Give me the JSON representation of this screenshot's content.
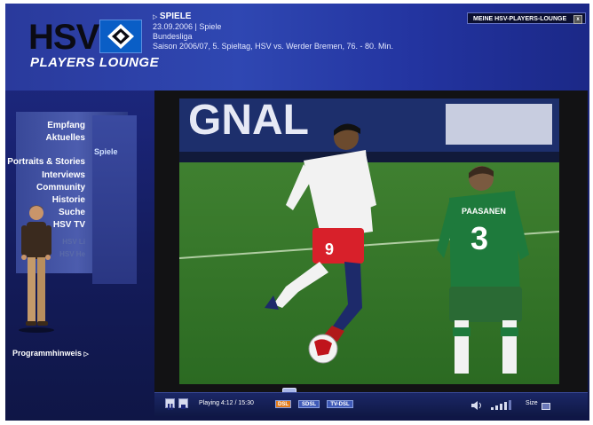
{
  "header": {
    "logo_main": "HSV",
    "logo_sub": "PLAYERS LOUNGE",
    "section": "SPIELE",
    "date_line": "23.09.2006 | Spiele",
    "league": "Bundesliga",
    "match_info": "Saison 2006/07, 5. Spieltag, HSV vs. Werder Bremen, 76. - 80. Min.",
    "lounge_button": "MEINE HSV-PLAYERS-LOUNGE",
    "close_label": "x"
  },
  "nav": {
    "items": [
      "Empfang",
      "Aktuelles",
      "Portraits & Stories",
      "Interviews",
      "Community",
      "Historie",
      "Suche",
      "HSV TV"
    ],
    "active_sub": "Spiele",
    "dim_items": [
      "HSV Li",
      "HSV He"
    ],
    "program_note": "Programmhinweis"
  },
  "video": {
    "ad_banner_text": "GNAL",
    "player9_number": "9",
    "player3_number": "3",
    "player3_name": "PAASANEN"
  },
  "controls": {
    "status": "Playing 4:12 / 15:30",
    "quality_buttons": [
      "DSL",
      "SDSL",
      "TV-DSL"
    ],
    "size_label": "Size"
  },
  "colors": {
    "frame_bg": "#1a2476",
    "header_bg": "#2f47b2",
    "dsl_active": "#e07a1c",
    "quality_inactive": "#3f5ab8"
  }
}
